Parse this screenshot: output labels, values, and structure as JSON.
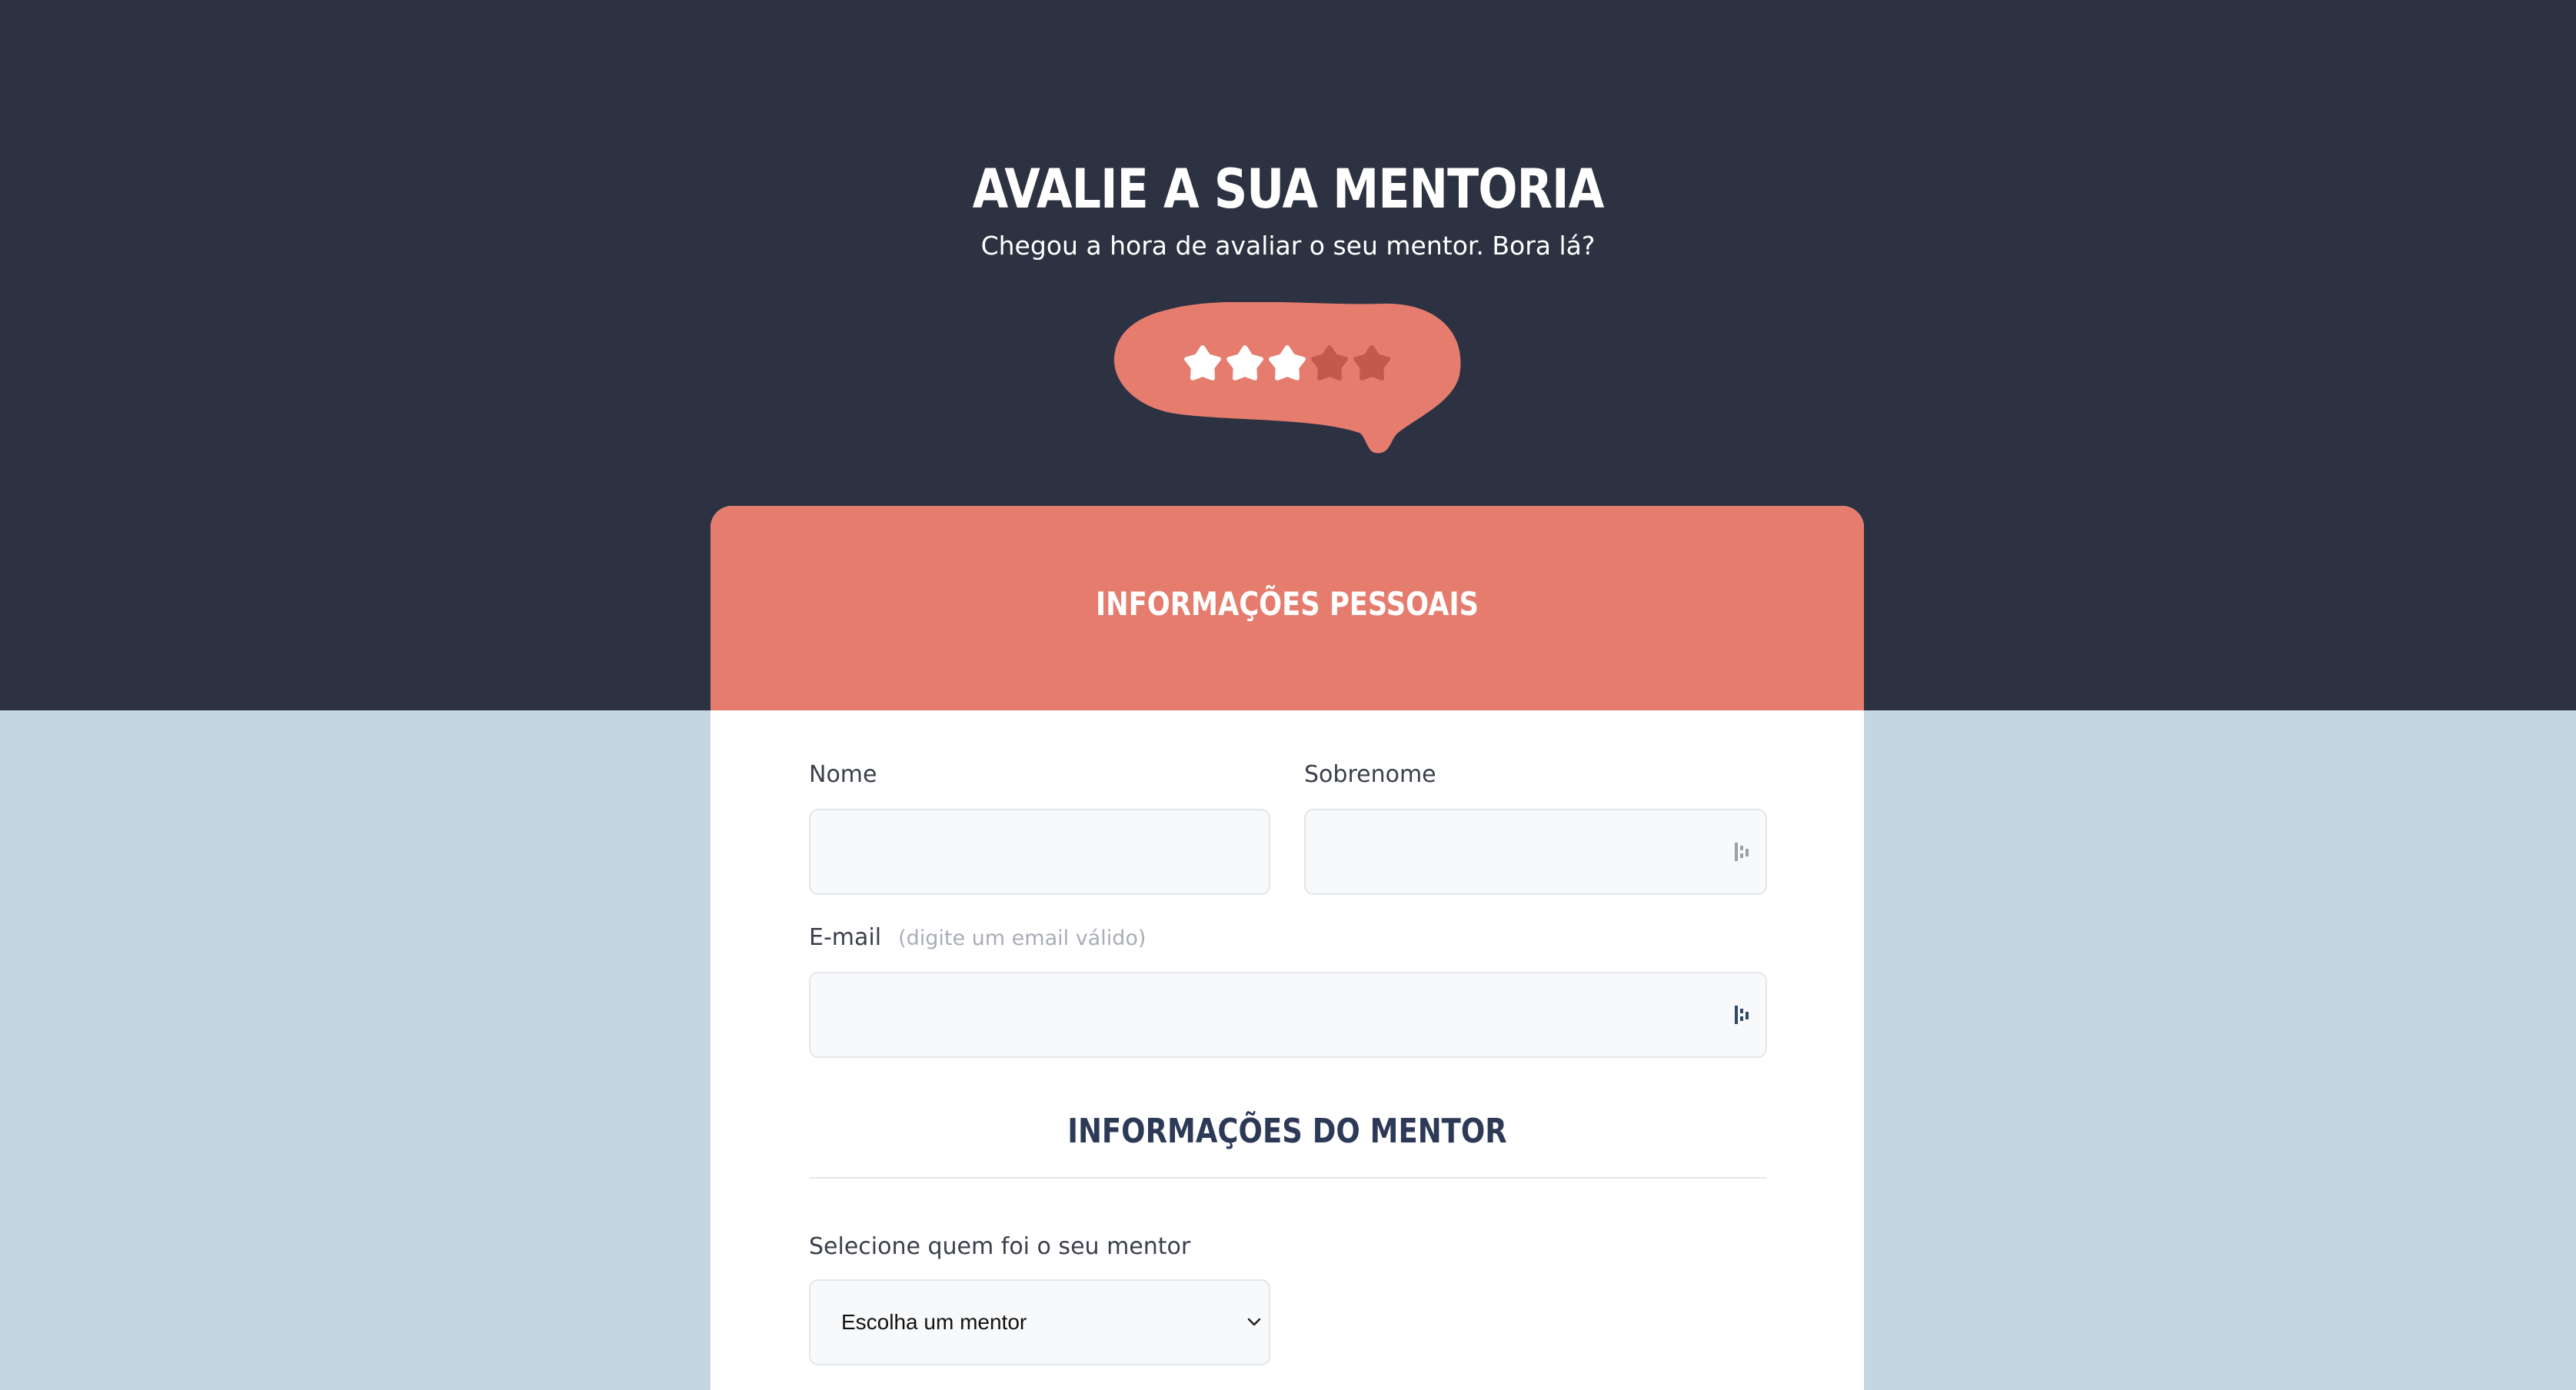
{
  "hero": {
    "title": "AVALIE A SUA MENTORIA",
    "subtitle": "Chegou a hora de avaliar o seu mentor. Bora lá?"
  },
  "rating": {
    "value": 3,
    "max": 5,
    "bubble_color": "#e57c6e",
    "star_filled_color": "#ffffff",
    "star_empty_color": "#c2594c"
  },
  "personal_section": {
    "title": "INFORMAÇÕES PESSOAIS"
  },
  "form": {
    "first_name_label": "Nome",
    "first_name_value": "",
    "last_name_label": "Sobrenome",
    "last_name_value": "",
    "email_label": "E-mail",
    "email_hint": "(digite um email válido)",
    "email_value": ""
  },
  "mentor_section": {
    "title": "INFORMAÇÕES DO MENTOR",
    "select_label": "Selecione quem foi o seu mentor",
    "select_value": "Escolha um mentor"
  },
  "colors": {
    "top_band": "#2c3241",
    "page_background": "#c3d6e2",
    "accent": "#e57c6e",
    "section_title": "#2c3a57"
  }
}
